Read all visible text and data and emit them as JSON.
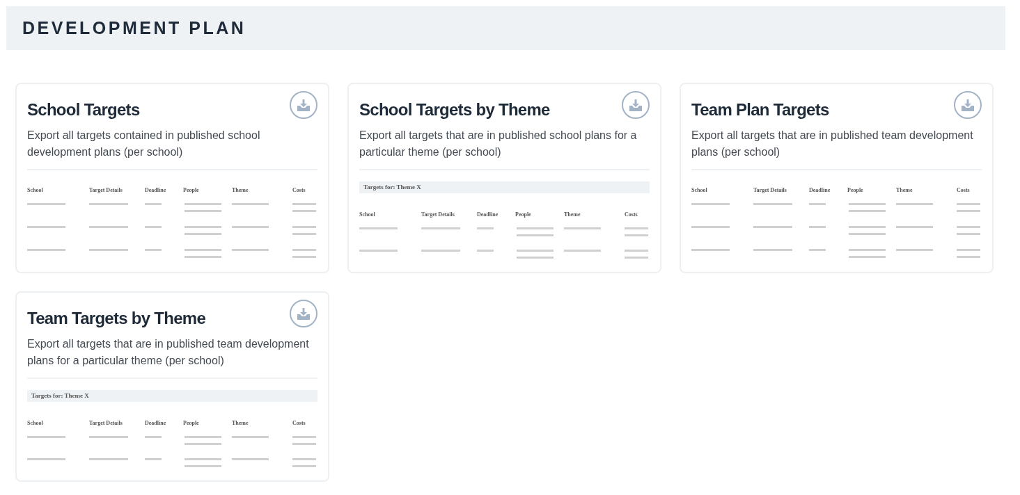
{
  "header": {
    "title": "DEVELOPMENT PLAN"
  },
  "cards": [
    {
      "title": "School Targets",
      "description": "Export all targets contained in published school development plans (per school)",
      "preview": {
        "columns": [
          {
            "label": "School",
            "kind": "single"
          },
          {
            "label": "Target Details",
            "kind": "single"
          },
          {
            "label": "Deadline",
            "kind": "single"
          },
          {
            "label": "People",
            "kind": "double"
          },
          {
            "label": "Theme",
            "kind": "single"
          },
          {
            "label": "Costs",
            "kind": "double"
          }
        ],
        "rows": [
          {
            "kind": "placeholder"
          },
          {
            "kind": "placeholder"
          },
          {
            "kind": "placeholder"
          }
        ]
      }
    },
    {
      "title": "School Targets by Theme",
      "description": "Export all targets that are in published school plans for a particular theme (per school)",
      "preview": {
        "banner": "Targets for: Theme X",
        "columns": [
          {
            "label": "School",
            "kind": "single"
          },
          {
            "label": "Target Details",
            "kind": "single"
          },
          {
            "label": "Deadline",
            "kind": "single"
          },
          {
            "label": "People",
            "kind": "double"
          },
          {
            "label": "Theme",
            "kind": "single"
          },
          {
            "label": "Costs",
            "kind": "double"
          }
        ],
        "rows": [
          {
            "kind": "placeholder"
          },
          {
            "kind": "placeholder"
          }
        ]
      }
    },
    {
      "title": "Team Plan Targets",
      "description": "Export all targets that are in published team development plans (per school)",
      "preview": {
        "columns": [
          {
            "label": "School",
            "kind": "single"
          },
          {
            "label": "Target Details",
            "kind": "single"
          },
          {
            "label": "Deadline",
            "kind": "single"
          },
          {
            "label": "People",
            "kind": "double"
          },
          {
            "label": "Theme",
            "kind": "single"
          },
          {
            "label": "Costs",
            "kind": "double"
          }
        ],
        "rows": [
          {
            "kind": "placeholder"
          },
          {
            "kind": "placeholder"
          },
          {
            "kind": "placeholder"
          }
        ]
      }
    },
    {
      "title": "Team Targets by Theme",
      "description": "Export all targets that are in published team development plans for a particular theme (per school)",
      "preview": {
        "banner": "Targets for: Theme X",
        "columns": [
          {
            "label": "School",
            "kind": "single"
          },
          {
            "label": "Target Details",
            "kind": "single"
          },
          {
            "label": "Deadline",
            "kind": "single"
          },
          {
            "label": "People",
            "kind": "double"
          },
          {
            "label": "Theme",
            "kind": "single"
          },
          {
            "label": "Costs",
            "kind": "double"
          }
        ],
        "rows": [
          {
            "kind": "placeholder"
          },
          {
            "kind": "placeholder"
          }
        ]
      }
    }
  ]
}
